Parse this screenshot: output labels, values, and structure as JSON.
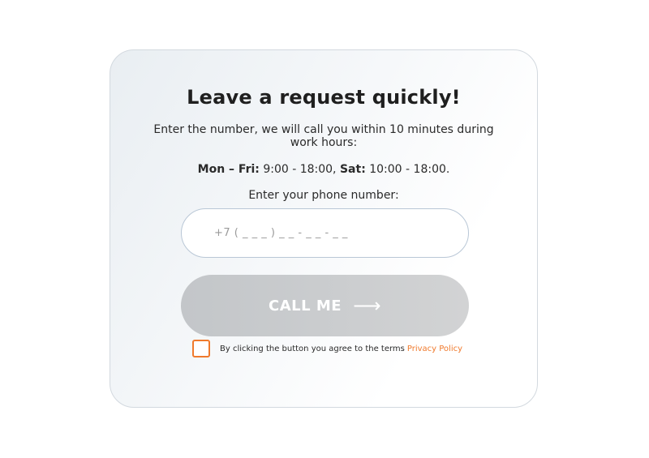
{
  "form": {
    "title": "Leave a request quickly!",
    "description": "Enter the number, we will call you within 10 minutes during work hours:",
    "hours": {
      "weekdays_label": "Mon – Fri:",
      "weekdays_time": " 9:00 - 18:00, ",
      "saturday_label": "Sat:",
      "saturday_time": " 10:00 - 18:00."
    },
    "phone_label": "Enter your phone number:",
    "phone_placeholder": "+7 ( _ _ _ ) _ _ - _ _ - _ _",
    "phone_value": "",
    "call_button_label": "CALL ME",
    "call_button_icon": "arrow-right-icon",
    "agree_text": "By clicking the button you agree to the terms",
    "privacy_link_text": "Privacy Policy",
    "checkbox_checked": false
  },
  "colors": {
    "accent": "#f07a2d",
    "button_disabled": "#c8cacc",
    "text": "#1f1f1f"
  }
}
